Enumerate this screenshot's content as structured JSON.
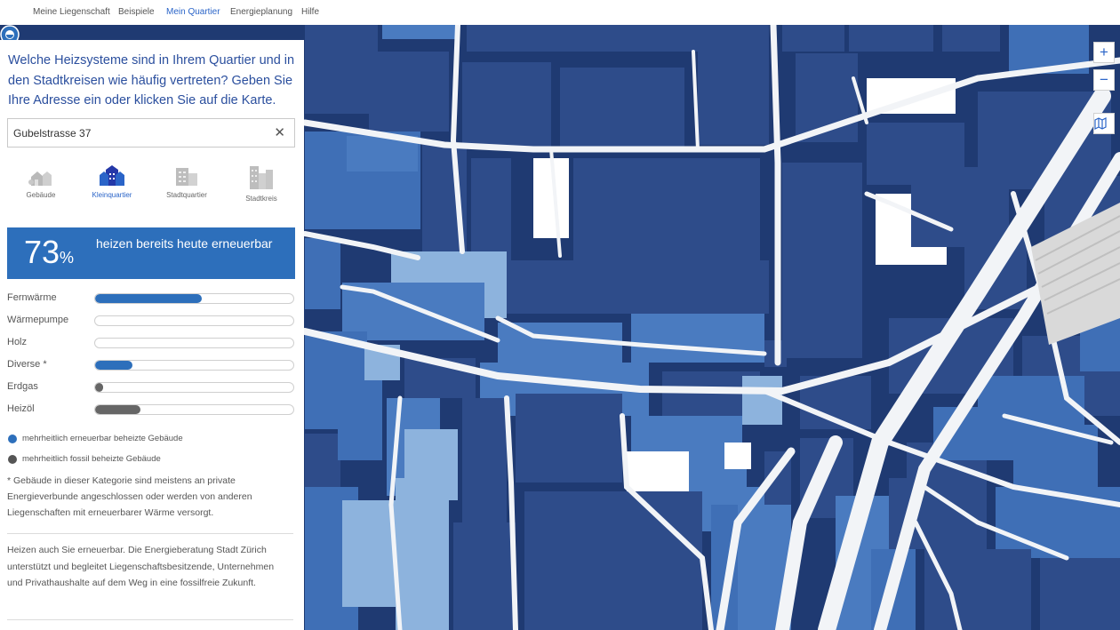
{
  "nav": {
    "items": [
      "Meine Liegenschaft",
      "Beispiele",
      "Mein Quartier",
      "Energieplanung",
      "Hilfe"
    ],
    "active": "Mein Quartier"
  },
  "panel": {
    "question": "Welche Heizsysteme sind in Ihrem Quartier und in den Stadtkreisen wie häufig vertreten? Geben Sie Ihre Adresse ein oder klicken Sie auf die Karte.",
    "search_value": "Gubelstrasse 37",
    "clear_icon": "close-icon",
    "levels": [
      {
        "label": "Gebäude",
        "icon": "house-icon",
        "active": false
      },
      {
        "label": "Kleinquartier",
        "icon": "neighborhood-icon",
        "active": true
      },
      {
        "label": "Stadtquartier",
        "icon": "district-icon",
        "active": false
      },
      {
        "label": "Stadtkreis",
        "icon": "city-district-icon",
        "active": false
      }
    ],
    "summary": {
      "percent": "73",
      "unit": "%",
      "text": "heizen bereits heute erneuerbar"
    },
    "bars": [
      {
        "label": "Fernwärme",
        "fraction": 0.54,
        "color": "#2d6fbb"
      },
      {
        "label": "Wärmepumpe",
        "fraction": 0.0,
        "color": "#2d6fbb"
      },
      {
        "label": "Holz",
        "fraction": 0.0,
        "color": "#2d6fbb"
      },
      {
        "label": "Diverse *",
        "fraction": 0.19,
        "color": "#2d6fbb"
      },
      {
        "label": "Erdgas",
        "fraction": 0.04,
        "color": "#666666"
      },
      {
        "label": "Heizöl",
        "fraction": 0.23,
        "color": "#666666"
      }
    ],
    "legend": [
      {
        "label": "mehrheitlich erneuerbar beheizte Gebäude",
        "color": "#2d6fbb"
      },
      {
        "label": "mehrheitlich fossil beheizte Gebäude",
        "color": "#555555"
      }
    ],
    "footnote": "* Gebäude in dieser Kategorie sind meistens an private Energieverbunde angeschlossen oder werden von anderen Liegenschaften mit erneuerbarer Wärme versorgt.",
    "info": "Heizen auch Sie erneuerbar. Die Energieberatung Stadt Zürich unterstützt und begleitet Liegenschaftsbesitzende, Unternehmen und Privathaushalte auf dem Weg in eine fossilfreie Zukunft."
  },
  "map": {
    "zoom_in": "+",
    "zoom_out": "−",
    "layers_icon": "map-icon",
    "marker_icon": "location-pin-icon",
    "colors": {
      "dark": "#2e4c8a",
      "mid": "#3f6fb6",
      "light": "#8db3dd",
      "road": "#f2f4f7"
    }
  }
}
